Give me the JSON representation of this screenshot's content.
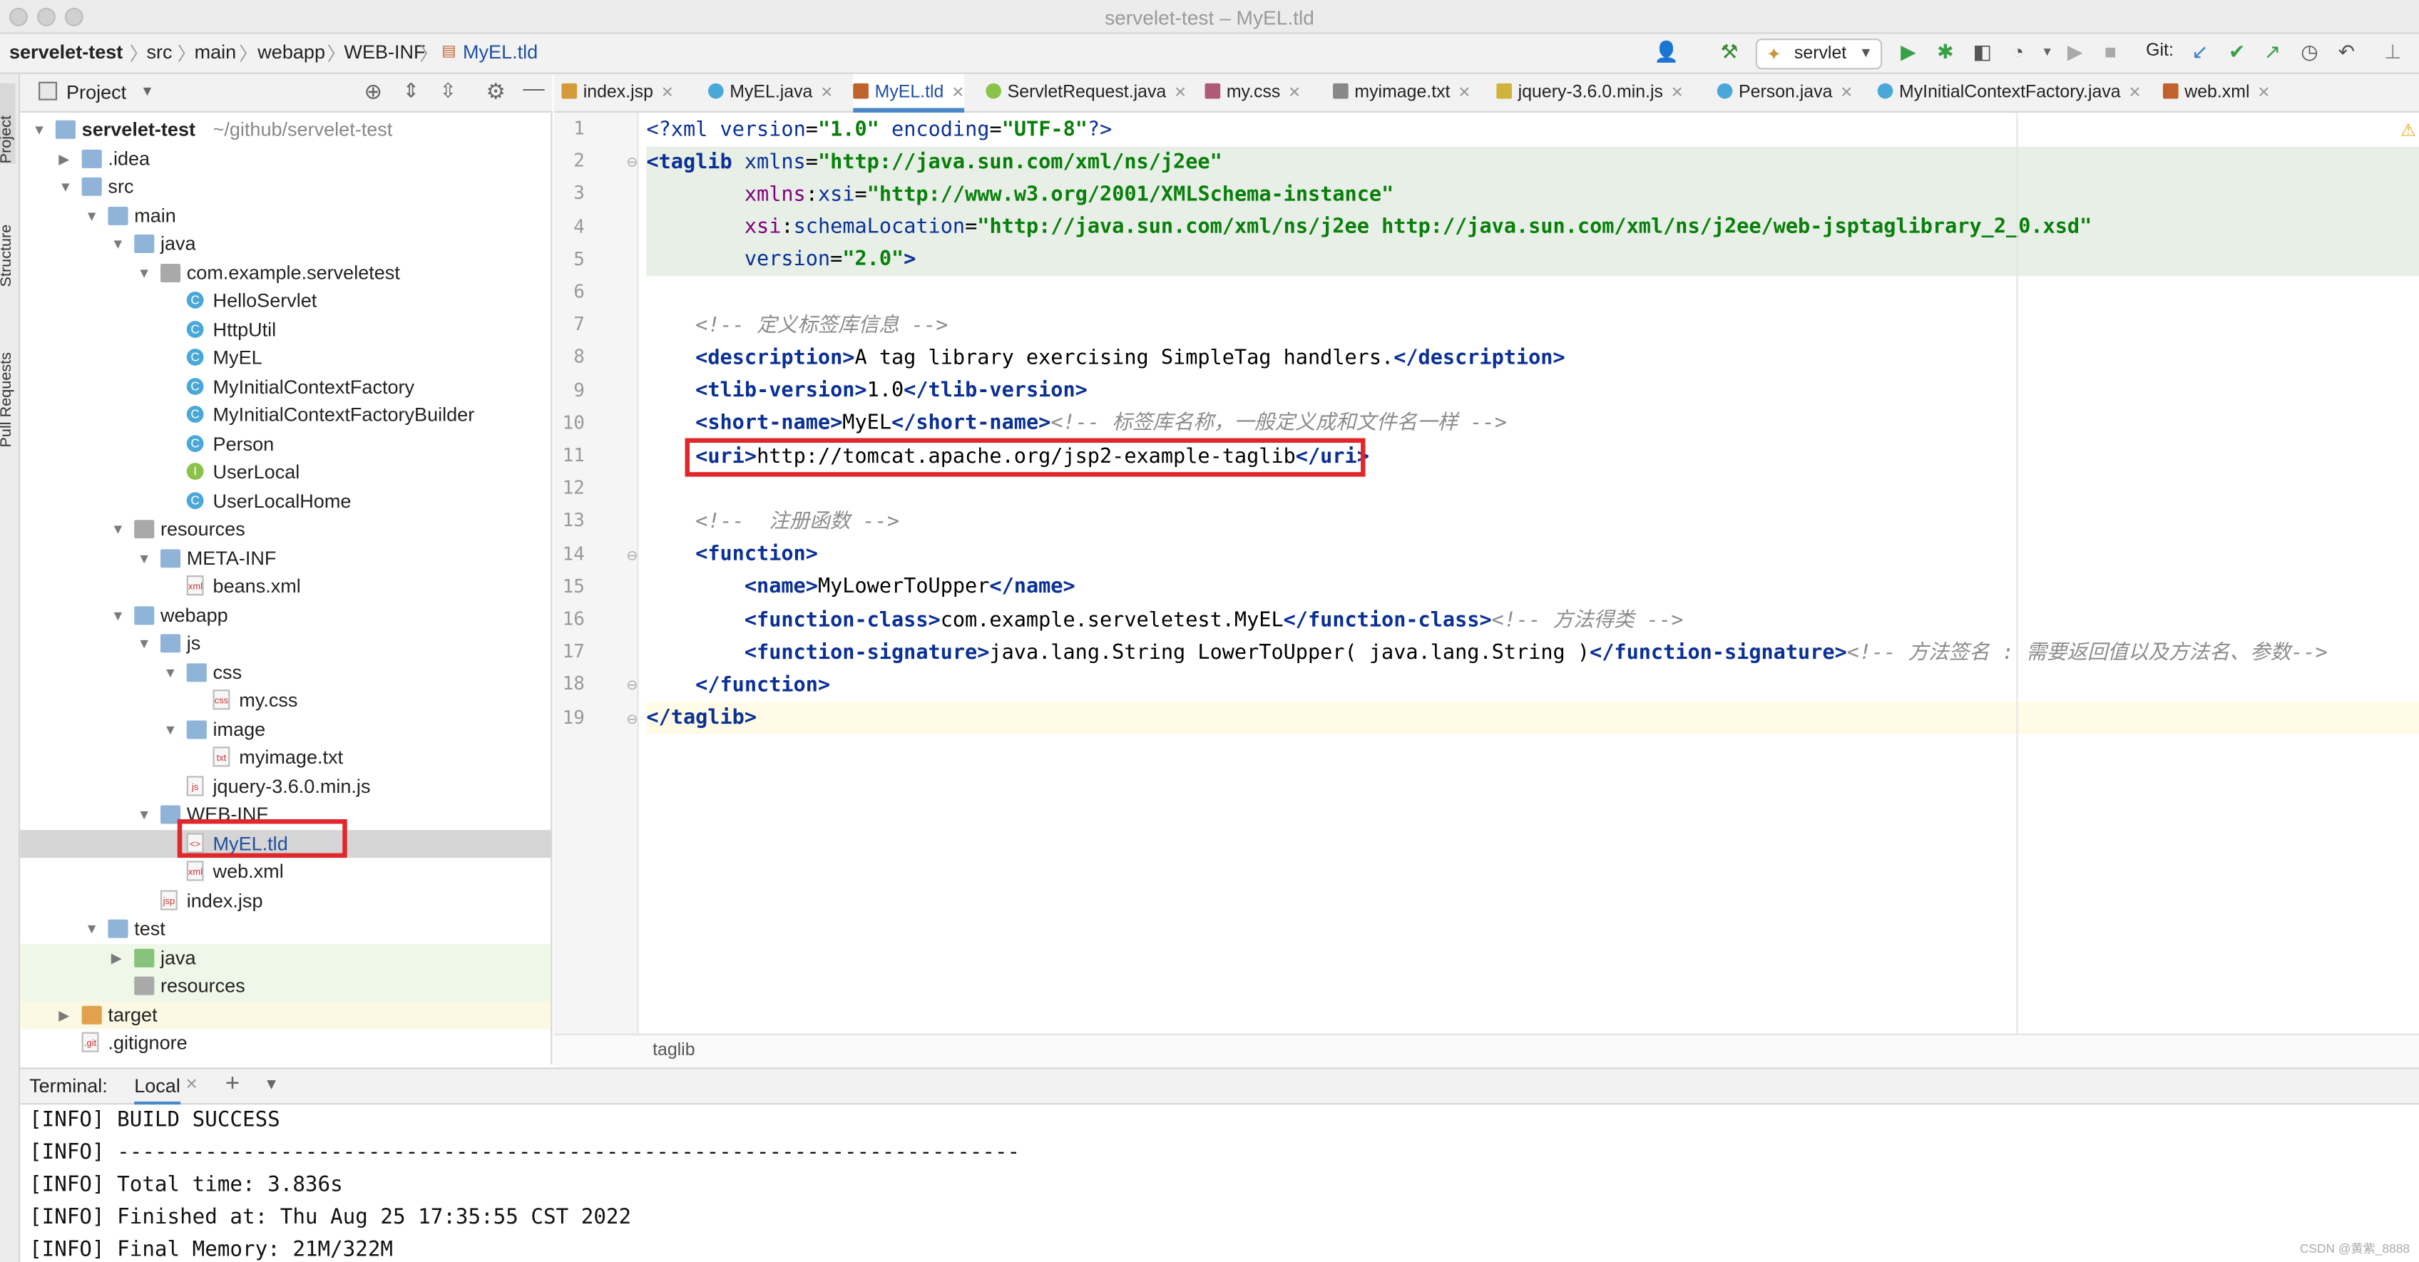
{
  "window": {
    "title": "servelet-test – MyEL.tld"
  },
  "breadcrumbs": [
    "servelet-test",
    "src",
    "main",
    "webapp",
    "WEB-INF",
    "MyEL.tld"
  ],
  "toolbar": {
    "run_config": "servlet",
    "git_label": "Git:"
  },
  "sidebar_tabs": [
    "Project",
    "Structure",
    "Pull Requests"
  ],
  "project_panel": {
    "title": "Project"
  },
  "tree": [
    {
      "label": "servelet-test",
      "suffix": "~/github/servelet-test",
      "icon": "folder-icon",
      "expanded": true,
      "bold": true
    },
    {
      "label": ".idea",
      "icon": "folder-icon",
      "expanded": false
    },
    {
      "label": "src",
      "icon": "folder-icon",
      "expanded": true
    },
    {
      "label": "main",
      "icon": "folder-icon",
      "expanded": true
    },
    {
      "label": "java",
      "icon": "source-folder-icon",
      "expanded": true
    },
    {
      "label": "com.example.serveletest",
      "icon": "package-icon",
      "expanded": true
    },
    {
      "label": "HelloServlet",
      "icon": "class-icon"
    },
    {
      "label": "HttpUtil",
      "icon": "class-icon"
    },
    {
      "label": "MyEL",
      "icon": "class-icon"
    },
    {
      "label": "MyInitialContextFactory",
      "icon": "class-icon"
    },
    {
      "label": "MyInitialContextFactoryBuilder",
      "icon": "class-icon"
    },
    {
      "label": "Person",
      "icon": "class-icon"
    },
    {
      "label": "UserLocal",
      "icon": "interface-icon"
    },
    {
      "label": "UserLocalHome",
      "icon": "class-icon"
    },
    {
      "label": "resources",
      "icon": "resources-folder-icon",
      "expanded": true
    },
    {
      "label": "META-INF",
      "icon": "folder-icon",
      "expanded": true
    },
    {
      "label": "beans.xml",
      "icon": "xml-file-icon"
    },
    {
      "label": "webapp",
      "icon": "web-folder-icon",
      "expanded": true
    },
    {
      "label": "js",
      "icon": "folder-icon",
      "expanded": true
    },
    {
      "label": "css",
      "icon": "folder-icon",
      "expanded": true
    },
    {
      "label": "my.css",
      "icon": "css-file-icon"
    },
    {
      "label": "image",
      "icon": "folder-icon",
      "expanded": true
    },
    {
      "label": "myimage.txt",
      "icon": "text-file-icon"
    },
    {
      "label": "jquery-3.6.0.min.js",
      "icon": "js-file-icon"
    },
    {
      "label": "WEB-INF",
      "icon": "folder-icon",
      "expanded": true
    },
    {
      "label": "MyEL.tld",
      "icon": "tld-file-icon",
      "selected": true
    },
    {
      "label": "web.xml",
      "icon": "xml-file-icon"
    },
    {
      "label": "index.jsp",
      "icon": "jsp-file-icon"
    },
    {
      "label": "test",
      "icon": "folder-icon",
      "expanded": true
    },
    {
      "label": "java",
      "icon": "test-source-folder-icon",
      "expanded": false
    },
    {
      "label": "resources",
      "icon": "test-resources-folder-icon"
    },
    {
      "label": "target",
      "icon": "excluded-folder-icon",
      "expanded": false
    },
    {
      "label": ".gitignore",
      "icon": "gitignore-file-icon"
    }
  ],
  "tabs": [
    {
      "label": "index.jsp",
      "icon": "jsp-file-icon"
    },
    {
      "label": "MyEL.java",
      "icon": "class-icon"
    },
    {
      "label": "MyEL.tld",
      "icon": "tld-file-icon",
      "active": true
    },
    {
      "label": "ServletRequest.java",
      "icon": "interface-icon"
    },
    {
      "label": "my.css",
      "icon": "css-file-icon"
    },
    {
      "label": "myimage.txt",
      "icon": "text-file-icon"
    },
    {
      "label": "jquery-3.6.0.min.js",
      "icon": "js-file-icon"
    },
    {
      "label": "Person.java",
      "icon": "class-icon"
    },
    {
      "label": "MyInitialContextFactory.java",
      "icon": "class-icon"
    },
    {
      "label": "web.xml",
      "icon": "xml-file-icon"
    }
  ],
  "editor": {
    "line_numbers": [
      "1",
      "2",
      "3",
      "4",
      "5",
      "6",
      "7",
      "8",
      "9",
      "10",
      "11",
      "12",
      "13",
      "14",
      "15",
      "16",
      "17",
      "18",
      "19"
    ],
    "lines": [
      "<?xml version=\"1.0\" encoding=\"UTF-8\"?>",
      "<taglib xmlns=\"http://java.sun.com/xml/ns/j2ee\"",
      "        xmlns:xsi=\"http://www.w3.org/2001/XMLSchema-instance\"",
      "        xsi:schemaLocation=\"http://java.sun.com/xml/ns/j2ee http://java.sun.com/xml/ns/j2ee/web-jsptaglibrary_2_0.xsd\"",
      "        version=\"2.0\">",
      "",
      "    <!-- 定义标签库信息 -->",
      "    <description>A tag library exercising SimpleTag handlers.</description>",
      "    <tlib-version>1.0</tlib-version>",
      "    <short-name>MyEL</short-name><!-- 标签库名称，一般定义成和文件名一样 -->",
      "    <uri>http://tomcat.apache.org/jsp2-example-taglib</uri>",
      "",
      "    <!--  注册函数 -->",
      "    <function>",
      "        <name>MyLowerToUpper</name>",
      "        <function-class>com.example.serveletest.MyEL</function-class><!-- 方法得类 -->",
      "        <function-signature>java.lang.String LowerToUpper( java.lang.String )</function-signature><!-- 方法签名 : 需要返回值以及方法名、参数-->",
      "    </function>",
      "</taglib>"
    ],
    "breadcrumb": "taglib"
  },
  "terminal": {
    "title": "Terminal:",
    "tab": "Local",
    "lines": [
      "[INFO] BUILD SUCCESS",
      "[INFO] ------------------------------------------------------------------------",
      "[INFO] Total time: 3.836s",
      "[INFO] Finished at: Thu Aug 25 17:35:55 CST 2022",
      "[INFO] Final Memory: 21M/322M"
    ]
  },
  "watermark": "CSDN @黄紫_8888",
  "colors": {
    "highlight": "#e0282c",
    "accent": "#4a88c7",
    "selection": "#d5d5d5"
  }
}
